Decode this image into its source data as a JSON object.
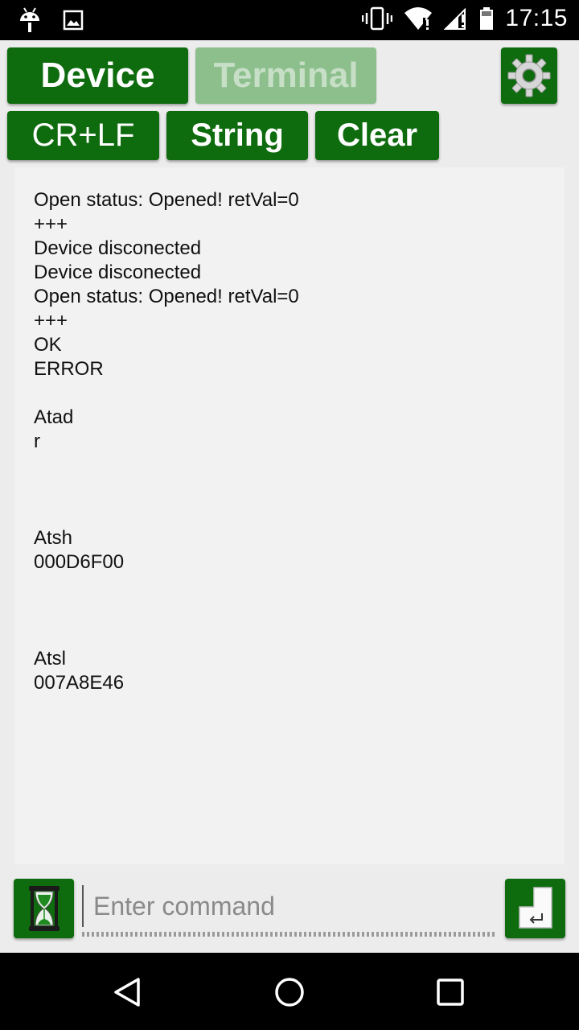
{
  "status_bar": {
    "time": "17:15",
    "left_icons": [
      "android-icon",
      "image-icon"
    ],
    "right_icons": [
      "vibrate-icon",
      "wifi-icon",
      "signal-icon",
      "battery-icon"
    ]
  },
  "toolbar": {
    "device_label": "Device",
    "terminal_label": "Terminal",
    "settings_icon": "gear-icon",
    "crlf_label": "CR+LF",
    "string_label": "String",
    "clear_label": "Clear"
  },
  "terminal": {
    "lines": [
      "Open status: Opened! retVal=0",
      "+++",
      "Device disconected",
      "Device disconected",
      "Open status: Opened! retVal=0",
      "+++",
      "OK",
      "ERROR",
      "",
      "Atad",
      "r",
      "",
      "",
      "",
      "Atsh",
      "000D6F00",
      "",
      "",
      "",
      "Atsl",
      "007A8E46"
    ]
  },
  "command": {
    "placeholder": "Enter command",
    "value": "",
    "hourglass_icon": "hourglass-icon",
    "enter_icon": "enter-key-icon"
  },
  "nav_bar": {
    "icons": [
      "back-icon",
      "home-icon",
      "recents-icon"
    ]
  },
  "colors": {
    "accent": "#0e6b0e",
    "accent_disabled": "#8dbf8d",
    "background": "#ececec",
    "terminal_bg": "#f2f2f2"
  }
}
